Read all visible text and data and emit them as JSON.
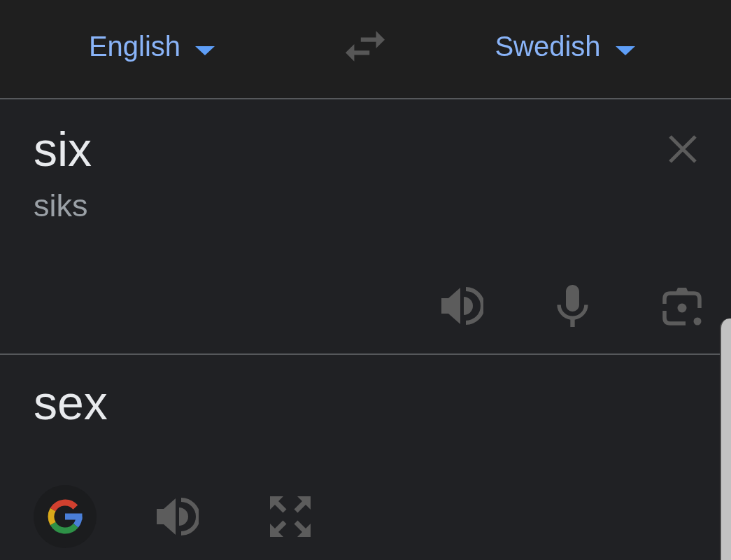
{
  "language_bar": {
    "source_language": {
      "label": "English"
    },
    "target_language": {
      "label": "Swedish"
    }
  },
  "source": {
    "text": "six",
    "transliteration": "siks"
  },
  "translation": {
    "text": "sex"
  }
}
